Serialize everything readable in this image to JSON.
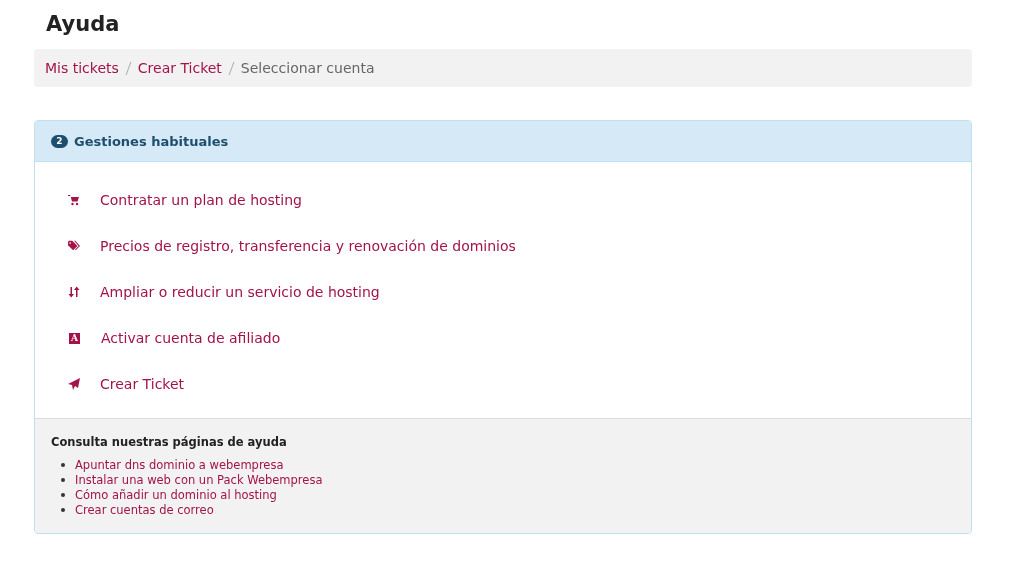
{
  "title": "Ayuda",
  "breadcrumb": [
    {
      "label": "Mis tickets",
      "kind": "link"
    },
    {
      "label": "Crear Ticket",
      "kind": "link"
    },
    {
      "label": "Seleccionar cuenta",
      "kind": "current"
    }
  ],
  "panel": {
    "step": "2",
    "title": "Gestiones habituales",
    "items": [
      {
        "label": "Contratar un plan de hosting",
        "kind": "cart"
      },
      {
        "label": "Precios de registro, transferencia y renovación de dominios",
        "kind": "tags"
      },
      {
        "label": "Ampliar o reducir un servicio de hosting",
        "kind": "sort"
      },
      {
        "label": "Activar cuenta de afiliado",
        "kind": "letter",
        "glyph": "A"
      },
      {
        "label": "Crear Ticket",
        "kind": "send"
      }
    ],
    "help": {
      "heading": "Consulta nuestras páginas de ayuda",
      "links": [
        "Apuntar dns dominio a webempresa",
        "Instalar una web con un Pack Webempresa",
        "Cómo añadir un dominio al hosting",
        "Crear cuentas de correo"
      ]
    }
  }
}
